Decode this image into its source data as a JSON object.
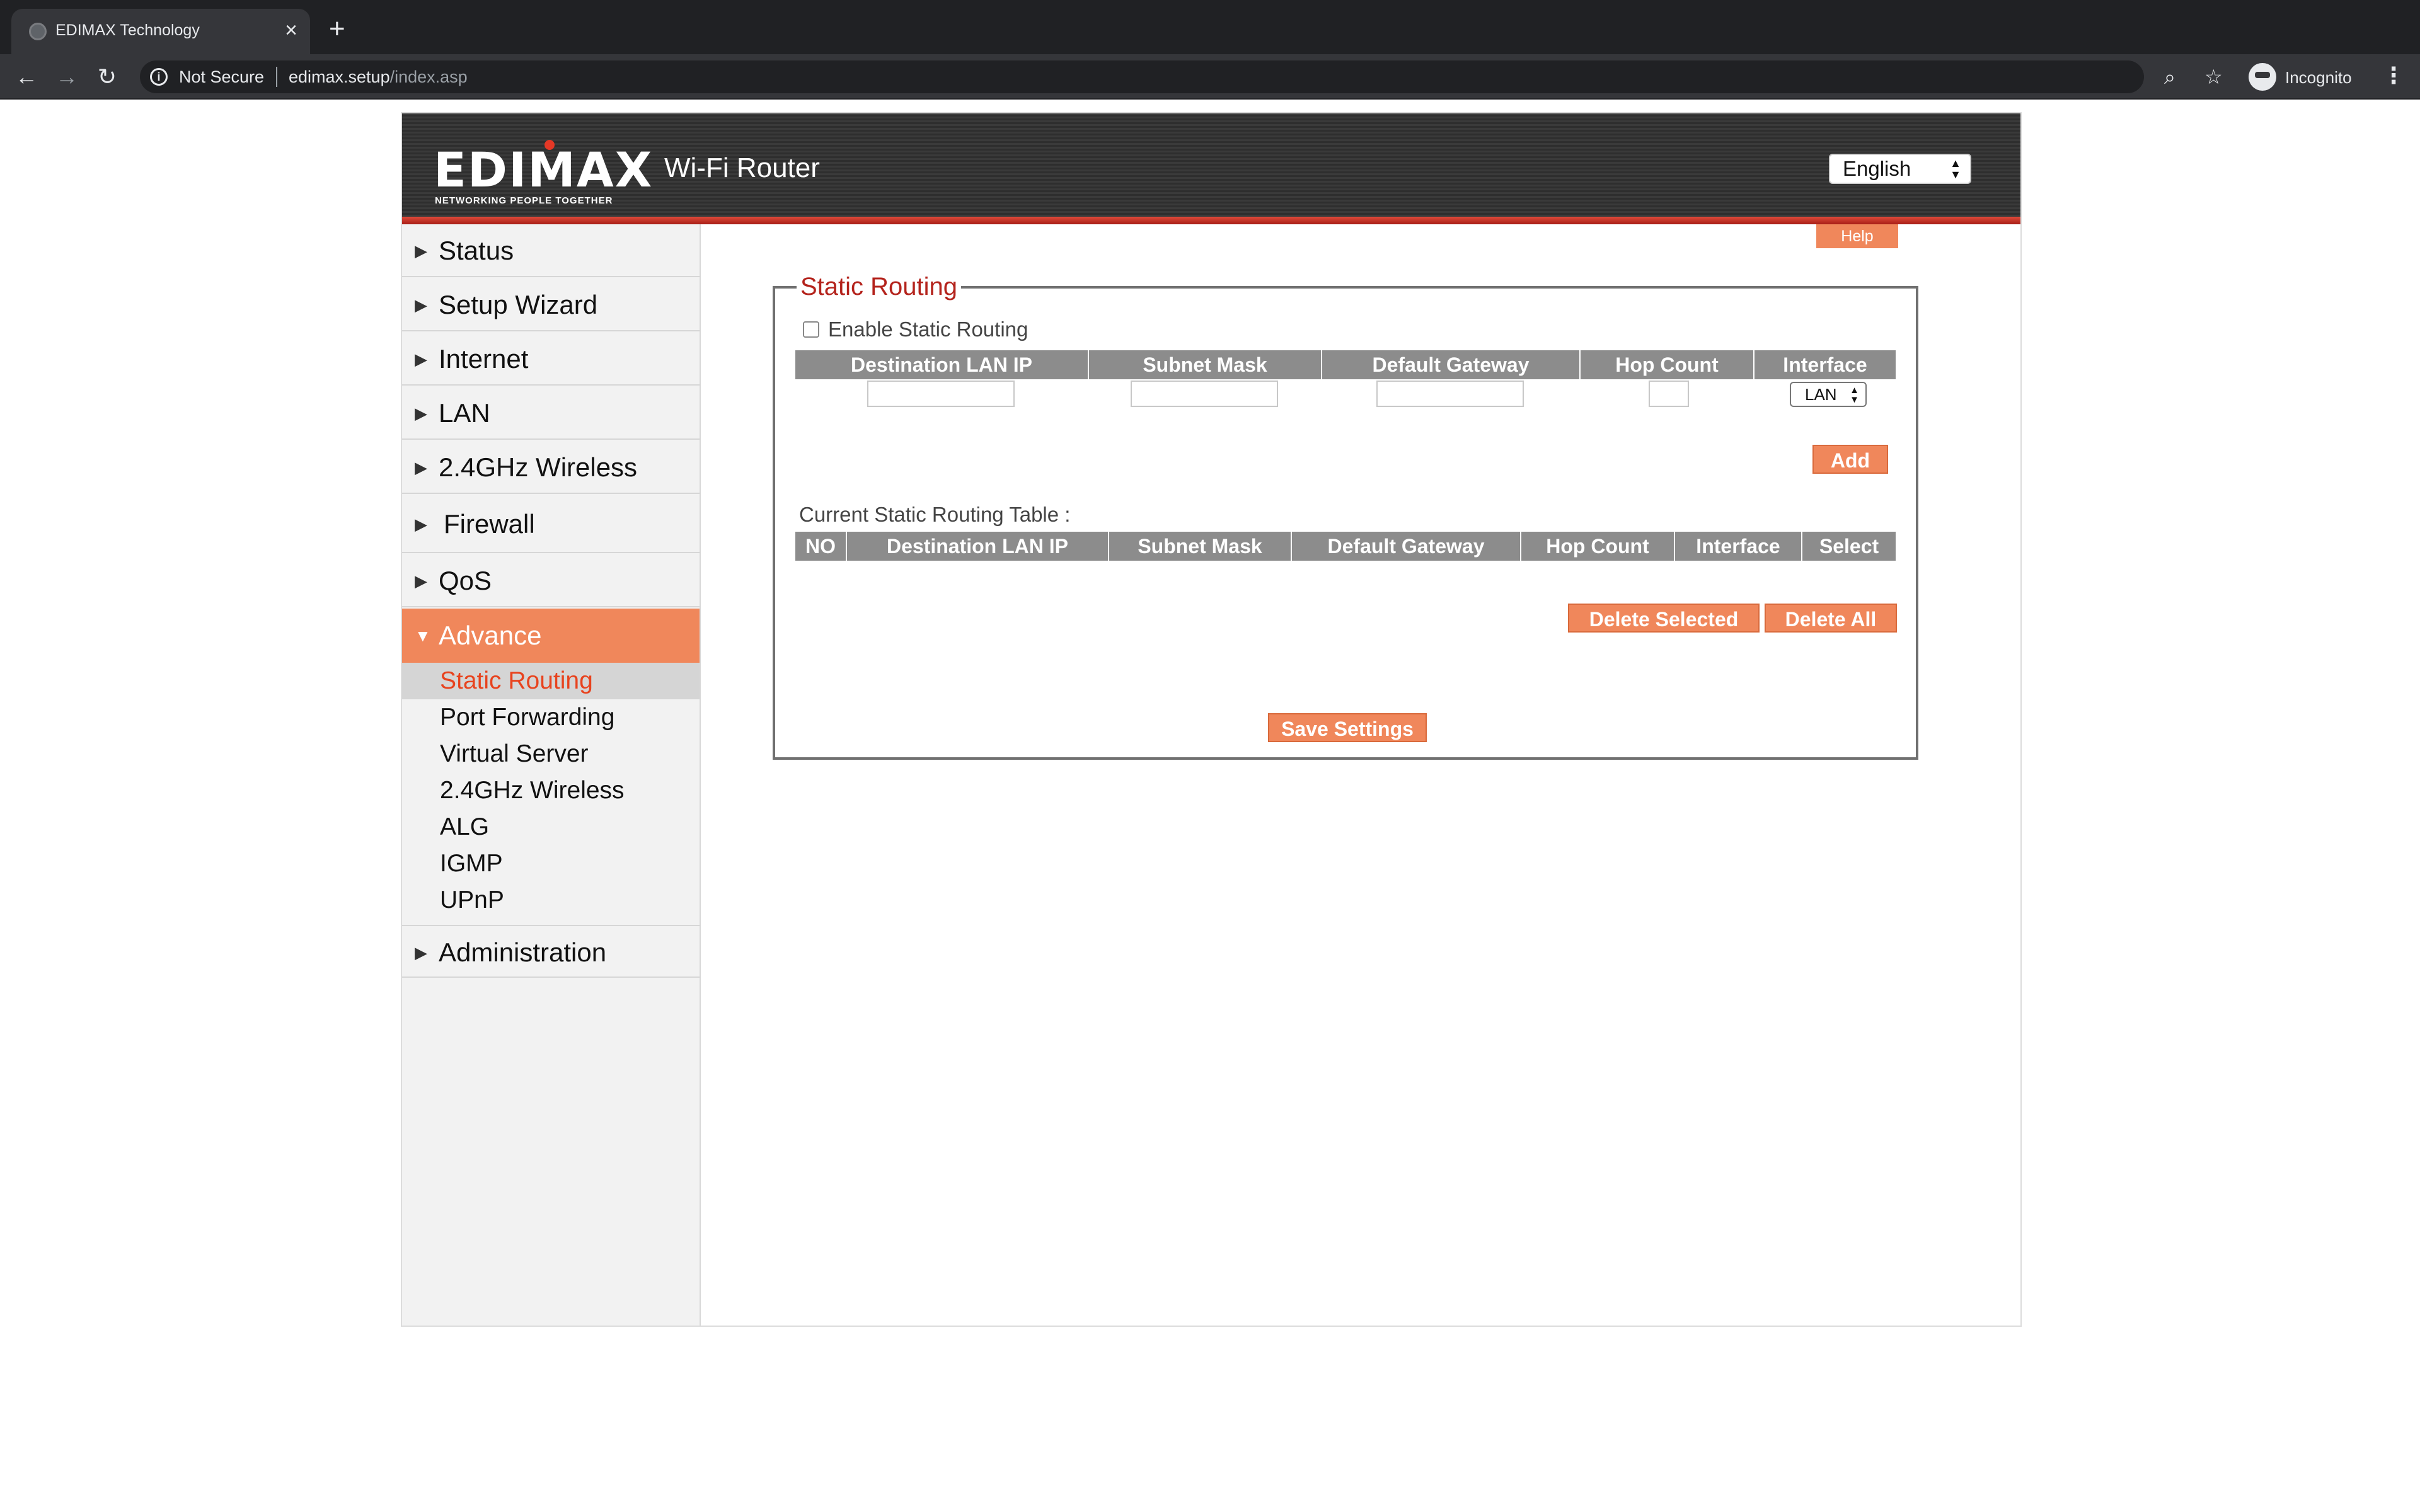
{
  "browser": {
    "tab_title": "EDIMAX Technology",
    "tab_close": "×",
    "new_tab": "+",
    "security_label": "Not Secure",
    "url_host": "edimax.setup",
    "url_path": "/index.asp",
    "profile_label": "Incognito",
    "icons": [
      "back-icon",
      "forward-icon",
      "reload-icon",
      "info-icon",
      "zoom-icon",
      "star-icon",
      "incognito-icon",
      "kebab-menu-icon"
    ]
  },
  "header": {
    "logo_text": "EDIMAX",
    "logo_tagline": "NETWORKING PEOPLE TOGETHER",
    "title": "Wi-Fi Router",
    "language": "English"
  },
  "sidebar": {
    "items": [
      {
        "label": "Status"
      },
      {
        "label": "Setup Wizard"
      },
      {
        "label": "Internet"
      },
      {
        "label": "LAN"
      },
      {
        "label": "2.4GHz Wireless"
      },
      {
        "label": "Firewall"
      },
      {
        "label": "QoS"
      },
      {
        "label": "Advance"
      },
      {
        "label": "Administration"
      }
    ],
    "advance_sub": [
      {
        "label": "Static Routing"
      },
      {
        "label": "Port Forwarding"
      },
      {
        "label": "Virtual Server"
      },
      {
        "label": "2.4GHz Wireless"
      },
      {
        "label": "ALG"
      },
      {
        "label": "IGMP"
      },
      {
        "label": "UPnP"
      }
    ]
  },
  "content": {
    "help_label": "Help",
    "section_title": "Static Routing",
    "enable_label": "Enable  Static Routing",
    "enable_checked": false,
    "input_headers": [
      "Destination LAN IP",
      "Subnet Mask",
      "Default Gateway",
      "Hop Count",
      "Interface"
    ],
    "interface_value": "LAN",
    "add_label": "Add",
    "current_table_label": "Current Static Routing Table :",
    "table_headers": [
      "NO",
      "Destination LAN IP",
      "Subnet Mask",
      "Default Gateway",
      "Hop Count",
      "Interface",
      "Select"
    ],
    "delete_selected_label": "Delete Selected",
    "delete_all_label": "Delete All",
    "save_label": "Save Settings"
  },
  "colors": {
    "accent": "#f0875b",
    "legend_red": "#b4231c",
    "header_bg": "#2e2e2e",
    "table_header": "#8c8c8c"
  }
}
